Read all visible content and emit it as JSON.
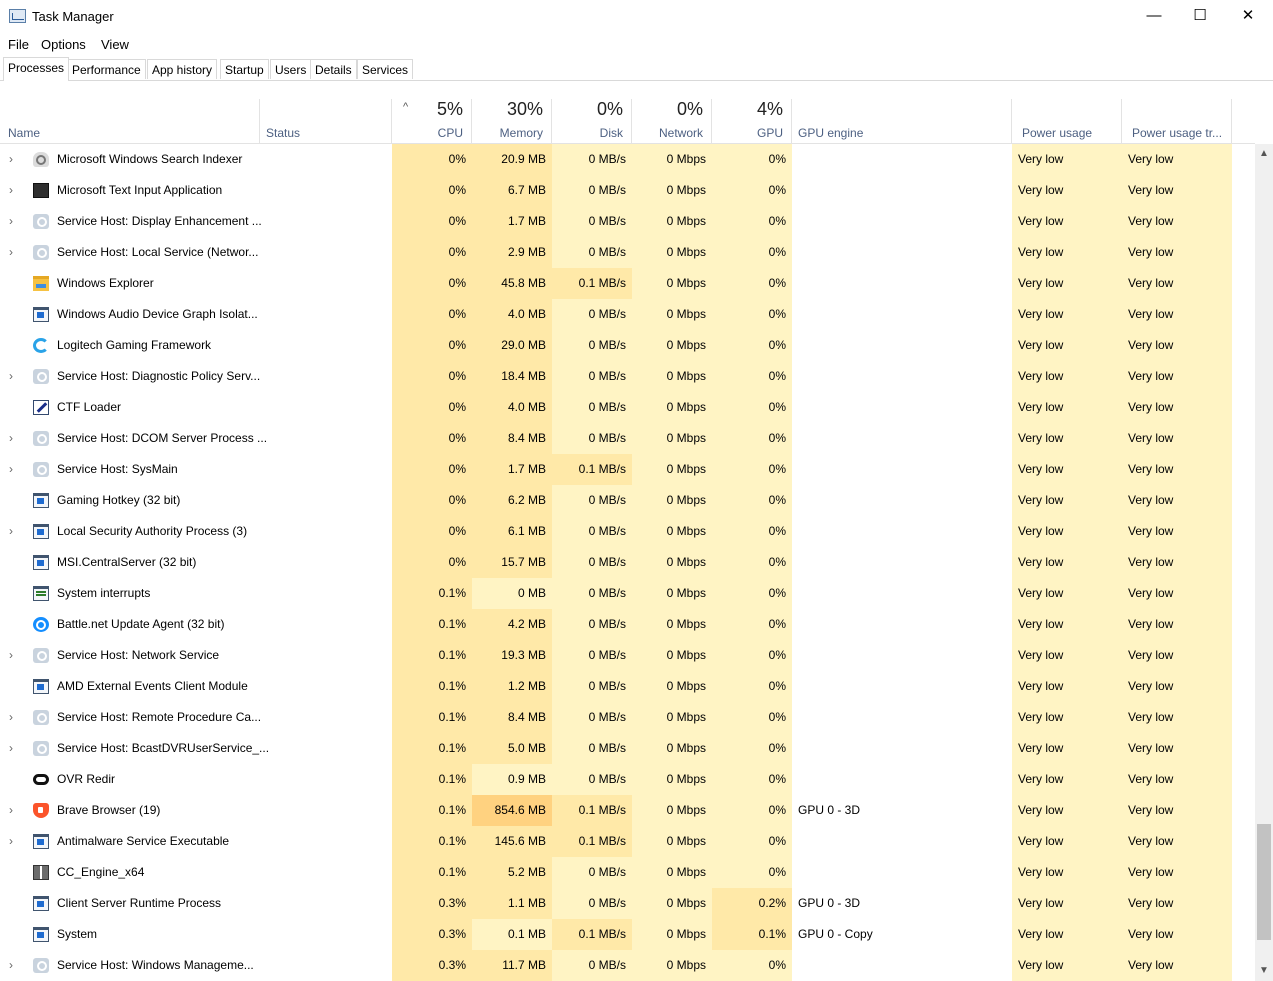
{
  "window": {
    "title": "Task Manager",
    "minimize": "—",
    "maximize": "☐",
    "close": "✕"
  },
  "menu": [
    "File",
    "Options",
    "View"
  ],
  "tabs": [
    "Processes",
    "Performance",
    "App history",
    "Startup",
    "Users",
    "Details",
    "Services"
  ],
  "active_tab": "Processes",
  "columns": {
    "name": "Name",
    "status": "Status",
    "cpu": {
      "pct": "5%",
      "label": "CPU"
    },
    "memory": {
      "pct": "30%",
      "label": "Memory"
    },
    "disk": {
      "pct": "0%",
      "label": "Disk"
    },
    "network": {
      "pct": "0%",
      "label": "Network"
    },
    "gpu": {
      "pct": "4%",
      "label": "GPU"
    },
    "gpu_engine": "GPU engine",
    "power": "Power usage",
    "power_trend": "Power usage tr..."
  },
  "colors": {
    "cell_light": "#fff4c4",
    "cell_mid": "#ffe9a8",
    "cell_strong": "#ffd280",
    "header_label": "#4d6082"
  },
  "processes": [
    {
      "name": "Microsoft Windows Search Indexer",
      "icon": "search-indexer-icon",
      "expandable": true,
      "cpu": "0%",
      "memory": "20.9 MB",
      "disk": "0 MB/s",
      "network": "0 Mbps",
      "gpu": "0%",
      "gpu_engine": "",
      "power": "Very low",
      "power_trend": "Very low"
    },
    {
      "name": "Microsoft Text Input Application",
      "icon": "text-input-icon",
      "expandable": true,
      "cpu": "0%",
      "memory": "6.7 MB",
      "disk": "0 MB/s",
      "network": "0 Mbps",
      "gpu": "0%",
      "gpu_engine": "",
      "power": "Very low",
      "power_trend": "Very low"
    },
    {
      "name": "Service Host: Display Enhancement ...",
      "icon": "service-host-gear-icon",
      "expandable": true,
      "cpu": "0%",
      "memory": "1.7 MB",
      "disk": "0 MB/s",
      "network": "0 Mbps",
      "gpu": "0%",
      "gpu_engine": "",
      "power": "Very low",
      "power_trend": "Very low"
    },
    {
      "name": "Service Host: Local Service (Networ...",
      "icon": "service-host-gear-icon",
      "expandable": true,
      "cpu": "0%",
      "memory": "2.9 MB",
      "disk": "0 MB/s",
      "network": "0 Mbps",
      "gpu": "0%",
      "gpu_engine": "",
      "power": "Very low",
      "power_trend": "Very low"
    },
    {
      "name": "Windows Explorer",
      "icon": "folder-icon",
      "expandable": false,
      "cpu": "0%",
      "memory": "45.8 MB",
      "disk": "0.1 MB/s",
      "network": "0 Mbps",
      "gpu": "0%",
      "gpu_engine": "",
      "power": "Very low",
      "power_trend": "Very low"
    },
    {
      "name": "Windows Audio Device Graph Isolat...",
      "icon": "app-window-icon",
      "expandable": false,
      "cpu": "0%",
      "memory": "4.0 MB",
      "disk": "0 MB/s",
      "network": "0 Mbps",
      "gpu": "0%",
      "gpu_engine": "",
      "power": "Very low",
      "power_trend": "Very low"
    },
    {
      "name": "Logitech Gaming Framework",
      "icon": "logitech-icon",
      "expandable": false,
      "cpu": "0%",
      "memory": "29.0 MB",
      "disk": "0 MB/s",
      "network": "0 Mbps",
      "gpu": "0%",
      "gpu_engine": "",
      "power": "Very low",
      "power_trend": "Very low"
    },
    {
      "name": "Service Host: Diagnostic Policy Serv...",
      "icon": "service-host-gear-icon",
      "expandable": true,
      "cpu": "0%",
      "memory": "18.4 MB",
      "disk": "0 MB/s",
      "network": "0 Mbps",
      "gpu": "0%",
      "gpu_engine": "",
      "power": "Very low",
      "power_trend": "Very low"
    },
    {
      "name": "CTF Loader",
      "icon": "ctf-loader-icon",
      "expandable": false,
      "cpu": "0%",
      "memory": "4.0 MB",
      "disk": "0 MB/s",
      "network": "0 Mbps",
      "gpu": "0%",
      "gpu_engine": "",
      "power": "Very low",
      "power_trend": "Very low"
    },
    {
      "name": "Service Host: DCOM Server Process ...",
      "icon": "service-host-gear-icon",
      "expandable": true,
      "cpu": "0%",
      "memory": "8.4 MB",
      "disk": "0 MB/s",
      "network": "0 Mbps",
      "gpu": "0%",
      "gpu_engine": "",
      "power": "Very low",
      "power_trend": "Very low"
    },
    {
      "name": "Service Host: SysMain",
      "icon": "service-host-gear-icon",
      "expandable": true,
      "cpu": "0%",
      "memory": "1.7 MB",
      "disk": "0.1 MB/s",
      "network": "0 Mbps",
      "gpu": "0%",
      "gpu_engine": "",
      "power": "Very low",
      "power_trend": "Very low"
    },
    {
      "name": "Gaming Hotkey (32 bit)",
      "icon": "app-window-icon",
      "expandable": false,
      "cpu": "0%",
      "memory": "6.2 MB",
      "disk": "0 MB/s",
      "network": "0 Mbps",
      "gpu": "0%",
      "gpu_engine": "",
      "power": "Very low",
      "power_trend": "Very low"
    },
    {
      "name": "Local Security Authority Process (3)",
      "icon": "app-window-icon",
      "expandable": true,
      "cpu": "0%",
      "memory": "6.1 MB",
      "disk": "0 MB/s",
      "network": "0 Mbps",
      "gpu": "0%",
      "gpu_engine": "",
      "power": "Very low",
      "power_trend": "Very low"
    },
    {
      "name": "MSI.CentralServer (32 bit)",
      "icon": "app-window-icon",
      "expandable": false,
      "cpu": "0%",
      "memory": "15.7 MB",
      "disk": "0 MB/s",
      "network": "0 Mbps",
      "gpu": "0%",
      "gpu_engine": "",
      "power": "Very low",
      "power_trend": "Very low"
    },
    {
      "name": "System interrupts",
      "icon": "system-interrupts-icon",
      "expandable": false,
      "cpu": "0.1%",
      "memory": "0 MB",
      "disk": "0 MB/s",
      "network": "0 Mbps",
      "gpu": "0%",
      "gpu_engine": "",
      "power": "Very low",
      "power_trend": "Very low"
    },
    {
      "name": "Battle.net Update Agent (32 bit)",
      "icon": "battle-net-icon",
      "expandable": false,
      "cpu": "0.1%",
      "memory": "4.2 MB",
      "disk": "0 MB/s",
      "network": "0 Mbps",
      "gpu": "0%",
      "gpu_engine": "",
      "power": "Very low",
      "power_trend": "Very low"
    },
    {
      "name": "Service Host: Network Service",
      "icon": "service-host-gear-icon",
      "expandable": true,
      "cpu": "0.1%",
      "memory": "19.3 MB",
      "disk": "0 MB/s",
      "network": "0 Mbps",
      "gpu": "0%",
      "gpu_engine": "",
      "power": "Very low",
      "power_trend": "Very low"
    },
    {
      "name": "AMD External Events Client Module",
      "icon": "app-window-icon",
      "expandable": false,
      "cpu": "0.1%",
      "memory": "1.2 MB",
      "disk": "0 MB/s",
      "network": "0 Mbps",
      "gpu": "0%",
      "gpu_engine": "",
      "power": "Very low",
      "power_trend": "Very low"
    },
    {
      "name": "Service Host: Remote Procedure Ca...",
      "icon": "service-host-gear-icon",
      "expandable": true,
      "cpu": "0.1%",
      "memory": "8.4 MB",
      "disk": "0 MB/s",
      "network": "0 Mbps",
      "gpu": "0%",
      "gpu_engine": "",
      "power": "Very low",
      "power_trend": "Very low"
    },
    {
      "name": "Service Host: BcastDVRUserService_...",
      "icon": "service-host-gear-icon",
      "expandable": true,
      "cpu": "0.1%",
      "memory": "5.0 MB",
      "disk": "0 MB/s",
      "network": "0 Mbps",
      "gpu": "0%",
      "gpu_engine": "",
      "power": "Very low",
      "power_trend": "Very low"
    },
    {
      "name": "OVR Redir",
      "icon": "oculus-icon",
      "expandable": false,
      "cpu": "0.1%",
      "memory": "0.9 MB",
      "disk": "0 MB/s",
      "network": "0 Mbps",
      "gpu": "0%",
      "gpu_engine": "",
      "power": "Very low",
      "power_trend": "Very low"
    },
    {
      "name": "Brave Browser (19)",
      "icon": "brave-icon",
      "expandable": true,
      "cpu": "0.1%",
      "memory": "854.6 MB",
      "disk": "0.1 MB/s",
      "network": "0 Mbps",
      "gpu": "0%",
      "gpu_engine": "GPU 0 - 3D",
      "power": "Very low",
      "power_trend": "Very low"
    },
    {
      "name": "Antimalware Service Executable",
      "icon": "app-window-icon",
      "expandable": true,
      "cpu": "0.1%",
      "memory": "145.6 MB",
      "disk": "0.1 MB/s",
      "network": "0 Mbps",
      "gpu": "0%",
      "gpu_engine": "",
      "power": "Very low",
      "power_trend": "Very low"
    },
    {
      "name": "CC_Engine_x64",
      "icon": "gift-box-icon",
      "expandable": false,
      "cpu": "0.1%",
      "memory": "5.2 MB",
      "disk": "0 MB/s",
      "network": "0 Mbps",
      "gpu": "0%",
      "gpu_engine": "",
      "power": "Very low",
      "power_trend": "Very low"
    },
    {
      "name": "Client Server Runtime Process",
      "icon": "app-window-icon",
      "expandable": false,
      "cpu": "0.3%",
      "memory": "1.1 MB",
      "disk": "0 MB/s",
      "network": "0 Mbps",
      "gpu": "0.2%",
      "gpu_engine": "GPU 0 - 3D",
      "power": "Very low",
      "power_trend": "Very low"
    },
    {
      "name": "System",
      "icon": "app-window-icon",
      "expandable": false,
      "cpu": "0.3%",
      "memory": "0.1 MB",
      "disk": "0.1 MB/s",
      "network": "0 Mbps",
      "gpu": "0.1%",
      "gpu_engine": "GPU 0 - Copy",
      "power": "Very low",
      "power_trend": "Very low"
    },
    {
      "name": "Service Host: Windows Manageme...",
      "icon": "service-host-gear-icon",
      "expandable": true,
      "cpu": "0.3%",
      "memory": "11.7 MB",
      "disk": "0 MB/s",
      "network": "0 Mbps",
      "gpu": "0%",
      "gpu_engine": "",
      "power": "Very low",
      "power_trend": "Very low"
    }
  ]
}
